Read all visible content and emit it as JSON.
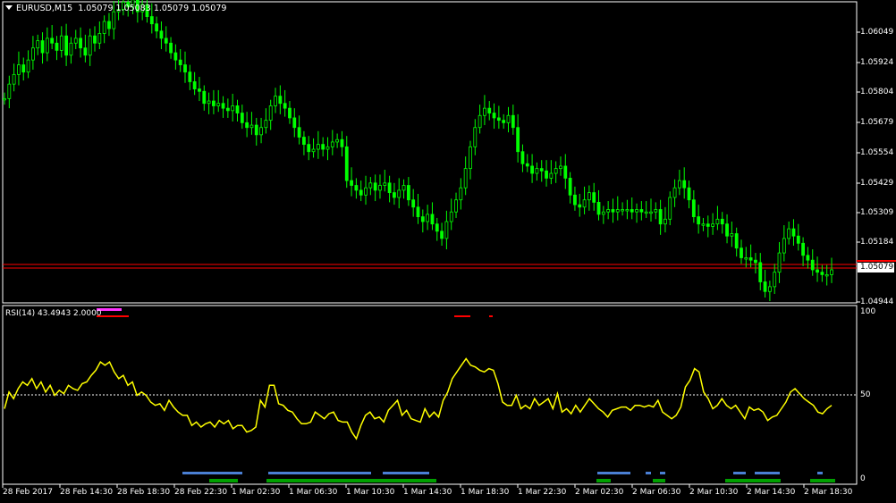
{
  "window": {
    "symbol_title": "EURUSD,M15",
    "ohlc": "1.05079 1.05083 1.05079 1.05079",
    "current_price": "1.05079",
    "indicator_title": "RSI(14) 43.4943 2.0000"
  },
  "colors": {
    "background": "#000000",
    "candle": "#00ff00",
    "rsi_line": "#ffff00",
    "grid": "#ffffff",
    "price_line": "#ff0000",
    "blue_bar": "#4a7fd4",
    "green_bar": "#00a000",
    "magenta_bar": "#ff33ff"
  },
  "price_axis": {
    "ticks": [
      "1.06049",
      "1.05924",
      "1.05804",
      "1.05679",
      "1.05554",
      "1.05429",
      "1.05309",
      "1.05184",
      "1.04944"
    ]
  },
  "rsi_axis": {
    "ticks": [
      "100",
      "50",
      "0"
    ]
  },
  "time_axis": {
    "ticks": [
      "28 Feb 2017",
      "28 Feb 14:30",
      "28 Feb 18:30",
      "28 Feb 22:30",
      "1 Mar 02:30",
      "1 Mar 06:30",
      "1 Mar 10:30",
      "1 Mar 14:30",
      "1 Mar 18:30",
      "1 Mar 22:30",
      "2 Mar 02:30",
      "2 Mar 06:30",
      "2 Mar 10:30",
      "2 Mar 14:30",
      "2 Mar 18:30"
    ]
  },
  "chart_data": [
    {
      "type": "line",
      "name": "price-candles",
      "ylim": [
        1.04944,
        1.06174
      ],
      "x": [
        0,
        5,
        10,
        15,
        20,
        25,
        30,
        35,
        40,
        45,
        50,
        55,
        60,
        65,
        70,
        75,
        80,
        85,
        90,
        95,
        100,
        105,
        110,
        115,
        120,
        125,
        130,
        135,
        140,
        145,
        150,
        155,
        160,
        165,
        170,
        175,
        180,
        185,
        190,
        195,
        200,
        205,
        210,
        215,
        220,
        225,
        230,
        235,
        240,
        245,
        250,
        255,
        260,
        265,
        270,
        275,
        280,
        285,
        290,
        295,
        300,
        305,
        310,
        315,
        320,
        325,
        330,
        335,
        340,
        345,
        350,
        355,
        360,
        365,
        370,
        375,
        380,
        385,
        390,
        395,
        400,
        405,
        410,
        415,
        420,
        425,
        430,
        435,
        440,
        445,
        450,
        455,
        460,
        465,
        470,
        475,
        480,
        485,
        490,
        495,
        500,
        505,
        510,
        515,
        520,
        525,
        530,
        535,
        540,
        545,
        550,
        555,
        560,
        565,
        570,
        575,
        580,
        585,
        590,
        595,
        600,
        605,
        610,
        615,
        620,
        625,
        630,
        635,
        640,
        645,
        650,
        655,
        660,
        665,
        670,
        675,
        680,
        685,
        690,
        695,
        700,
        705,
        710,
        715,
        720,
        725,
        730,
        735,
        740,
        745,
        750,
        755,
        760,
        765,
        770,
        775,
        780,
        785,
        790,
        795,
        800,
        805,
        810,
        815,
        820,
        825,
        830,
        835,
        840,
        845,
        850,
        855,
        860,
        865,
        870,
        875,
        880,
        885,
        890,
        895,
        900,
        905,
        910,
        915,
        920,
        925,
        930
      ],
      "values": [
        1.0578,
        1.0584,
        1.0588,
        1.0592,
        1.0589,
        1.0594,
        1.0599,
        1.0602,
        1.0597,
        1.0603,
        1.0601,
        1.0598,
        1.0604,
        1.0596,
        1.0601,
        1.0603,
        1.0599,
        1.0596,
        1.0604,
        1.0601,
        1.0605,
        1.061,
        1.0607,
        1.0614,
        1.0615,
        1.0618,
        1.0616,
        1.0619,
        1.0614,
        1.0617,
        1.0612,
        1.0609,
        1.0606,
        1.0603,
        1.0601,
        1.0597,
        1.0594,
        1.0592,
        1.0589,
        1.0585,
        1.0582,
        1.0581,
        1.0576,
        1.0577,
        1.0575,
        1.0576,
        1.0574,
        1.0573,
        1.0575,
        1.0572,
        1.0568,
        1.0566,
        1.0567,
        1.0563,
        1.0566,
        1.0569,
        1.0575,
        1.0579,
        1.0576,
        1.0574,
        1.057,
        1.0566,
        1.0562,
        1.0559,
        1.0556,
        1.0557,
        1.0559,
        1.0557,
        1.0558,
        1.056,
        1.0561,
        1.0558,
        1.0544,
        1.0542,
        1.054,
        1.0538,
        1.0541,
        1.0543,
        1.054,
        1.0542,
        1.0543,
        1.0539,
        1.0537,
        1.054,
        1.0542,
        1.0536,
        1.0533,
        1.0529,
        1.0527,
        1.053,
        1.0526,
        1.0523,
        1.052,
        1.0527,
        1.0531,
        1.0536,
        1.0541,
        1.0549,
        1.0558,
        1.0566,
        1.0571,
        1.0574,
        1.0572,
        1.057,
        1.0569,
        1.0568,
        1.0571,
        1.0566,
        1.0556,
        1.0551,
        1.055,
        1.0547,
        1.0549,
        1.0548,
        1.0545,
        1.0547,
        1.0549,
        1.055,
        1.0545,
        1.0538,
        1.0534,
        1.0533,
        1.0536,
        1.0539,
        1.0535,
        1.053,
        1.0531,
        1.0532,
        1.0531,
        1.0532,
        1.0532,
        1.0532,
        1.0531,
        1.0532,
        1.0531,
        1.0531,
        1.0531,
        1.0532,
        1.0526,
        1.0528,
        1.0537,
        1.0541,
        1.0544,
        1.0541,
        1.0536,
        1.0529,
        1.0526,
        1.0526,
        1.0525,
        1.0526,
        1.0528,
        1.0526,
        1.0521,
        1.0522,
        1.0516,
        1.0512,
        1.0512,
        1.0511,
        1.051,
        1.0502,
        1.0498,
        1.05,
        1.0506,
        1.0514,
        1.052,
        1.0524,
        1.0521,
        1.0518,
        1.0513,
        1.0511,
        1.0507,
        1.0506,
        1.0505,
        1.0505,
        1.0507
      ]
    },
    {
      "type": "line",
      "name": "rsi-14",
      "ylim": [
        0,
        100
      ],
      "x": [
        0,
        5,
        10,
        15,
        20,
        25,
        30,
        35,
        40,
        45,
        50,
        55,
        60,
        65,
        70,
        75,
        80,
        85,
        90,
        95,
        100,
        105,
        110,
        115,
        120,
        125,
        130,
        135,
        140,
        145,
        150,
        155,
        160,
        165,
        170,
        175,
        180,
        185,
        190,
        195,
        200,
        205,
        210,
        215,
        220,
        225,
        230,
        235,
        240,
        245,
        250,
        255,
        260,
        265,
        270,
        275,
        280,
        285,
        290,
        295,
        300,
        305,
        310,
        315,
        320,
        325,
        330,
        335,
        340,
        345,
        350,
        355,
        360,
        365,
        370,
        375,
        380,
        385,
        390,
        395,
        400,
        405,
        410,
        415,
        420,
        425,
        430,
        435,
        440,
        445,
        450,
        455,
        460,
        465,
        470,
        475,
        480,
        485,
        490,
        495,
        500,
        505,
        510,
        515,
        520,
        525,
        530,
        535,
        540,
        545,
        550,
        555,
        560,
        565,
        570,
        575,
        580,
        585,
        590,
        595,
        600,
        605,
        610,
        615,
        620,
        625,
        630,
        635,
        640,
        645,
        650,
        655,
        660,
        665,
        670,
        675,
        680,
        685,
        690,
        695,
        700,
        705,
        710,
        715,
        720,
        725,
        730,
        735,
        740,
        745,
        750,
        755,
        760,
        765,
        770,
        775,
        780,
        785,
        790,
        795,
        800,
        805,
        810,
        815,
        820,
        825,
        830,
        835,
        840,
        845,
        850,
        855,
        860,
        865,
        870,
        875,
        880,
        885,
        890,
        895,
        900,
        905,
        910,
        915,
        920,
        925,
        930
      ],
      "values": [
        42,
        52,
        48,
        54,
        58,
        56,
        60,
        54,
        58,
        52,
        56,
        50,
        53,
        51,
        56,
        54,
        53,
        57,
        58,
        62,
        65,
        70,
        68,
        70,
        64,
        60,
        62,
        56,
        58,
        50,
        52,
        50,
        46,
        44,
        45,
        41,
        47,
        43,
        40,
        38,
        38,
        32,
        34,
        31,
        33,
        34,
        31,
        35,
        33,
        35,
        30,
        32,
        32,
        28,
        29,
        31,
        47,
        43,
        56,
        56,
        45,
        44,
        41,
        40,
        36,
        33,
        33,
        34,
        40,
        38,
        36,
        39,
        40,
        35,
        34,
        34,
        28,
        24,
        32,
        38,
        40,
        36,
        37,
        34,
        41,
        44,
        47,
        38,
        41,
        36,
        35,
        34,
        42,
        37,
        40,
        37,
        47,
        52,
        60,
        64,
        68,
        72,
        68,
        67,
        65,
        64,
        66,
        65,
        57,
        46,
        44,
        44,
        50,
        42,
        44,
        42,
        48,
        44,
        46,
        48,
        42,
        51,
        40,
        42,
        39,
        44,
        40,
        44,
        48,
        45,
        42,
        40,
        37,
        41,
        42,
        43,
        43,
        41,
        44,
        44,
        43,
        44,
        43,
        47,
        40,
        38,
        36,
        38,
        43,
        55,
        59,
        66,
        64,
        52,
        48,
        42,
        44,
        48,
        44,
        42,
        44,
        40,
        36,
        43,
        41,
        42,
        40,
        35,
        37,
        38,
        42,
        46,
        52,
        54,
        51,
        48,
        46,
        44,
        40,
        39,
        42,
        44
      ]
    }
  ]
}
